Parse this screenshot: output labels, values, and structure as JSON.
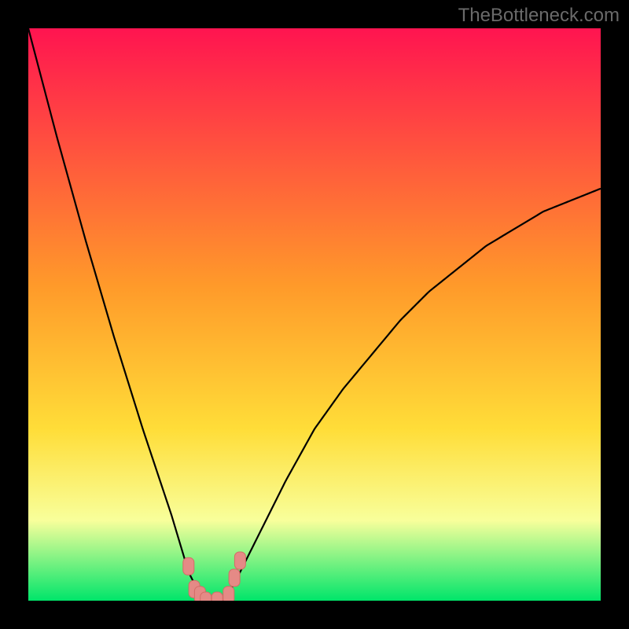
{
  "watermark": "TheBottleneck.com",
  "colors": {
    "page_bg": "#000000",
    "gradient_top": "#ff1450",
    "gradient_mid": "#ffdd38",
    "gradient_low": "#f8ff9b",
    "gradient_bottom": "#00e56a",
    "curve": "#000000",
    "marker_fill": "#e58a86",
    "marker_stroke": "#d46c66"
  },
  "chart_data": {
    "type": "line",
    "title": "",
    "xlabel": "",
    "ylabel": "",
    "xlim_fraction": [
      0,
      1
    ],
    "ylim_percent": [
      0,
      100
    ],
    "x": [
      0.0,
      0.05,
      0.1,
      0.15,
      0.2,
      0.25,
      0.28,
      0.3,
      0.32,
      0.34,
      0.36,
      0.4,
      0.45,
      0.5,
      0.55,
      0.6,
      0.65,
      0.7,
      0.75,
      0.8,
      0.85,
      0.9,
      0.95,
      1.0
    ],
    "y": [
      100,
      81,
      63,
      46,
      30,
      15,
      5,
      1,
      0,
      0,
      3,
      11,
      21,
      30,
      37,
      43,
      49,
      54,
      58,
      62,
      65,
      68,
      70,
      72
    ],
    "minimum_x": 0.33,
    "markers": [
      {
        "x": 0.28,
        "y": 6
      },
      {
        "x": 0.29,
        "y": 2
      },
      {
        "x": 0.3,
        "y": 1
      },
      {
        "x": 0.31,
        "y": 0
      },
      {
        "x": 0.33,
        "y": 0
      },
      {
        "x": 0.35,
        "y": 1
      },
      {
        "x": 0.36,
        "y": 4
      },
      {
        "x": 0.37,
        "y": 7
      }
    ],
    "annotations": []
  }
}
